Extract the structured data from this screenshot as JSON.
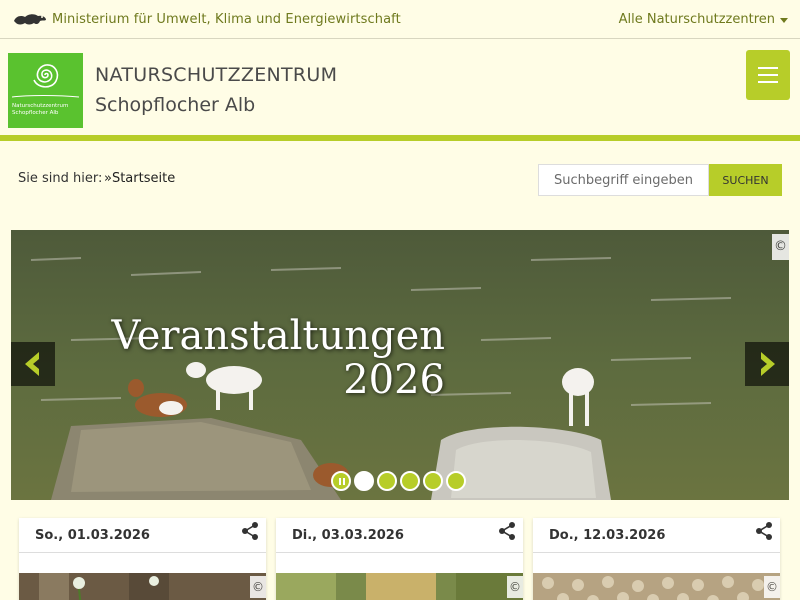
{
  "topbar": {
    "ministry": "Ministerium für Umwelt, Klima und Energiewirtschaft",
    "all_centers": "Alle Naturschutzzentren"
  },
  "header": {
    "logo_text_line1": "Naturschutzzentrum",
    "logo_text_line2": "Schopflocher Alb",
    "title_line1": "NATURSCHUTZZENTRUM",
    "title_line2": "Schopflocher Alb"
  },
  "breadcrumb": {
    "label": "Sie sind hier:",
    "current": "»Startseite"
  },
  "search": {
    "placeholder": "Suchbegriff eingeben",
    "button": "SUCHEN"
  },
  "slider": {
    "title_line1": "Veranstaltungen",
    "title_line2": "2026",
    "copyright": "©",
    "slide_count": 5,
    "active_slide": 1
  },
  "events": [
    {
      "date": "So., 01.03.2026",
      "copyright": "©"
    },
    {
      "date": "Di., 03.03.2026",
      "copyright": "©"
    },
    {
      "date": "Do., 12.03.2026",
      "copyright": "©"
    }
  ],
  "colors": {
    "accent": "#b7cd29",
    "background": "#fffde6",
    "ministry_text": "#6f7a1e",
    "logo_green": "#5ac22f"
  }
}
